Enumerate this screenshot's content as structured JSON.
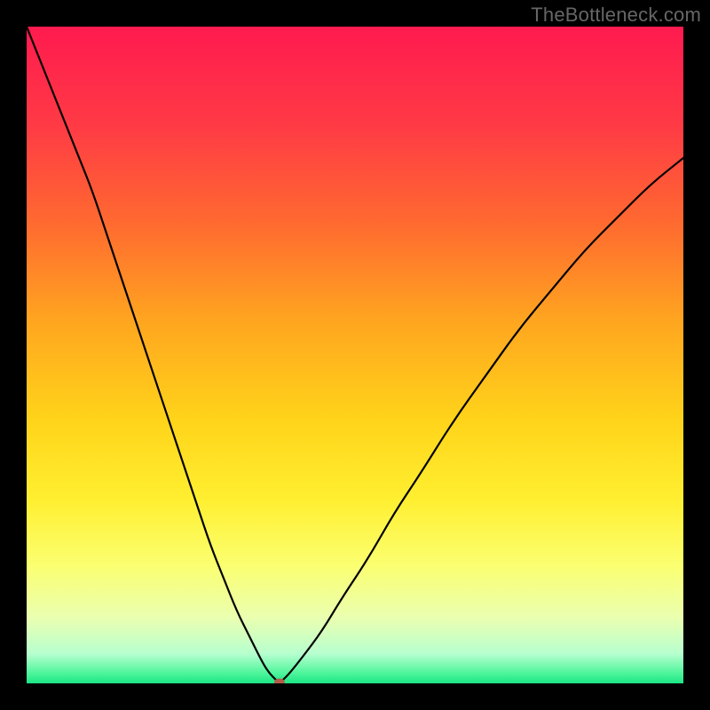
{
  "watermark": "TheBottleneck.com",
  "chart_data": {
    "type": "line",
    "title": "",
    "xlabel": "",
    "ylabel": "",
    "xlim": [
      0,
      100
    ],
    "ylim": [
      0,
      100
    ],
    "grid": false,
    "legend": false,
    "background": {
      "type": "vertical_gradient",
      "stops": [
        {
          "pos": 0.0,
          "color": "#ff1a4f"
        },
        {
          "pos": 0.15,
          "color": "#ff3a45"
        },
        {
          "pos": 0.3,
          "color": "#ff6a30"
        },
        {
          "pos": 0.45,
          "color": "#ffa61f"
        },
        {
          "pos": 0.6,
          "color": "#ffd41a"
        },
        {
          "pos": 0.72,
          "color": "#ffef30"
        },
        {
          "pos": 0.82,
          "color": "#fbff70"
        },
        {
          "pos": 0.9,
          "color": "#eaffb0"
        },
        {
          "pos": 0.955,
          "color": "#b7ffcf"
        },
        {
          "pos": 0.985,
          "color": "#4cf59a"
        },
        {
          "pos": 1.0,
          "color": "#1be584"
        }
      ]
    },
    "series": [
      {
        "name": "bottleneck-curve",
        "color": "#000000",
        "x": [
          0,
          2,
          4,
          6,
          8,
          10,
          12,
          14,
          16,
          18,
          20,
          22,
          24,
          26,
          28,
          30,
          32,
          34,
          36,
          37,
          38,
          38.5,
          39,
          40,
          42,
          45,
          48,
          52,
          56,
          60,
          65,
          70,
          75,
          80,
          85,
          90,
          95,
          100
        ],
        "y": [
          100,
          95,
          90,
          85,
          80,
          75,
          69,
          63,
          57,
          51,
          45,
          39,
          33,
          27,
          21,
          16,
          11,
          7,
          3,
          1.5,
          0.5,
          0,
          0.5,
          1.5,
          4,
          8,
          13,
          19,
          26,
          32,
          40,
          47,
          54,
          60,
          66,
          71,
          76,
          80
        ]
      }
    ],
    "marker": {
      "name": "optimal-point",
      "x": 38.5,
      "y": 0.2,
      "color": "#b55a4a",
      "rx": 0.8,
      "ry": 0.55
    }
  },
  "colors": {
    "frame": "#000000",
    "watermark": "#666666",
    "curve": "#000000",
    "marker": "#b55a4a"
  }
}
